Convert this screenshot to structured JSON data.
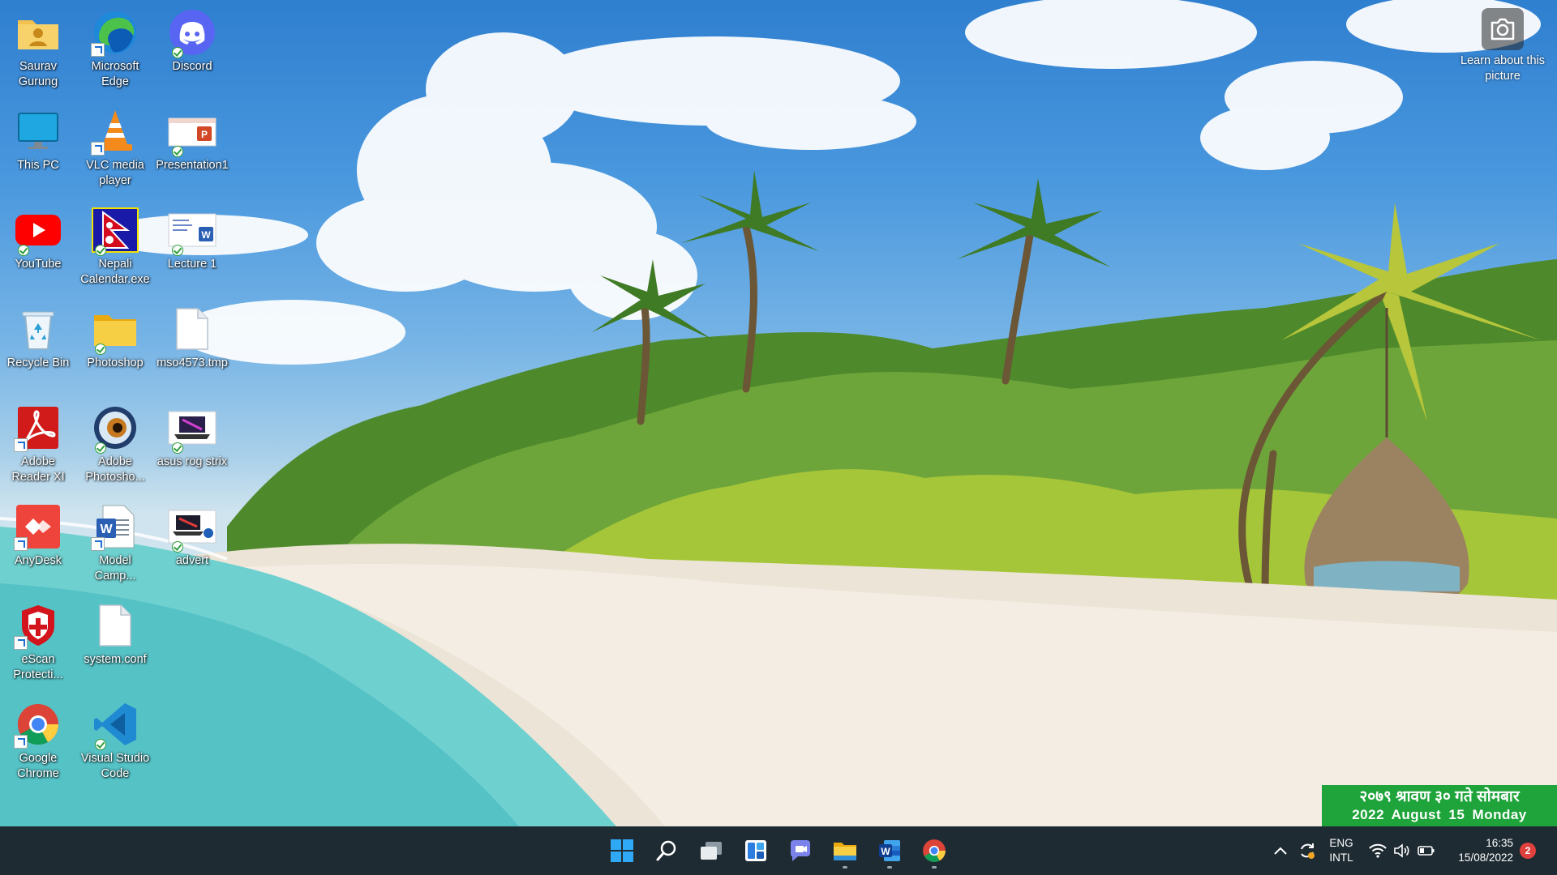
{
  "desktop": {
    "icons": [
      {
        "label": "Saurav Gurung"
      },
      {
        "label": "Microsoft Edge"
      },
      {
        "label": "Discord"
      },
      {
        "label": "This PC"
      },
      {
        "label": "VLC media player"
      },
      {
        "label": "Presentation1"
      },
      {
        "label": "YouTube"
      },
      {
        "label": "Nepali Calendar.exe"
      },
      {
        "label": "Lecture 1"
      },
      {
        "label": "Recycle Bin"
      },
      {
        "label": "Photoshop"
      },
      {
        "label": "mso4573.tmp"
      },
      {
        "label": "Adobe Reader XI"
      },
      {
        "label": "Adobe Photosho..."
      },
      {
        "label": "asus rog strix"
      },
      {
        "label": "AnyDesk"
      },
      {
        "label": "Model Camp..."
      },
      {
        "label": "advert"
      },
      {
        "label": "eScan Protecti..."
      },
      {
        "label": "system.conf"
      },
      {
        "label": "Google Chrome"
      },
      {
        "label": "Visual Studio Code"
      }
    ],
    "learn_about_picture": {
      "label": "Learn about this picture",
      "icon": "camera-icon"
    }
  },
  "nepali_date_widget": {
    "nepali_text": "२०७९ श्रावण ३० गते सोमबार",
    "english_text": "2022 August 15 Monday"
  },
  "taskbar": {
    "apps": [
      {
        "name": "start",
        "icon": "windows-logo-icon"
      },
      {
        "name": "search",
        "icon": "search-icon"
      },
      {
        "name": "task-view",
        "icon": "task-view-icon"
      },
      {
        "name": "widgets",
        "icon": "widgets-icon"
      },
      {
        "name": "chat",
        "icon": "teams-chat-icon"
      },
      {
        "name": "file-explorer",
        "icon": "file-explorer-icon"
      },
      {
        "name": "word",
        "icon": "word-icon"
      },
      {
        "name": "chrome",
        "icon": "chrome-icon"
      }
    ],
    "tray": {
      "language_line1": "ENG",
      "language_line2": "INTL",
      "time": "16:35",
      "date": "15/08/2022",
      "notification_count": "2"
    }
  },
  "colors": {
    "taskbar_bg": "#1f2b33",
    "widget_green": "#1fa43b",
    "notification_red": "#e0413d"
  }
}
